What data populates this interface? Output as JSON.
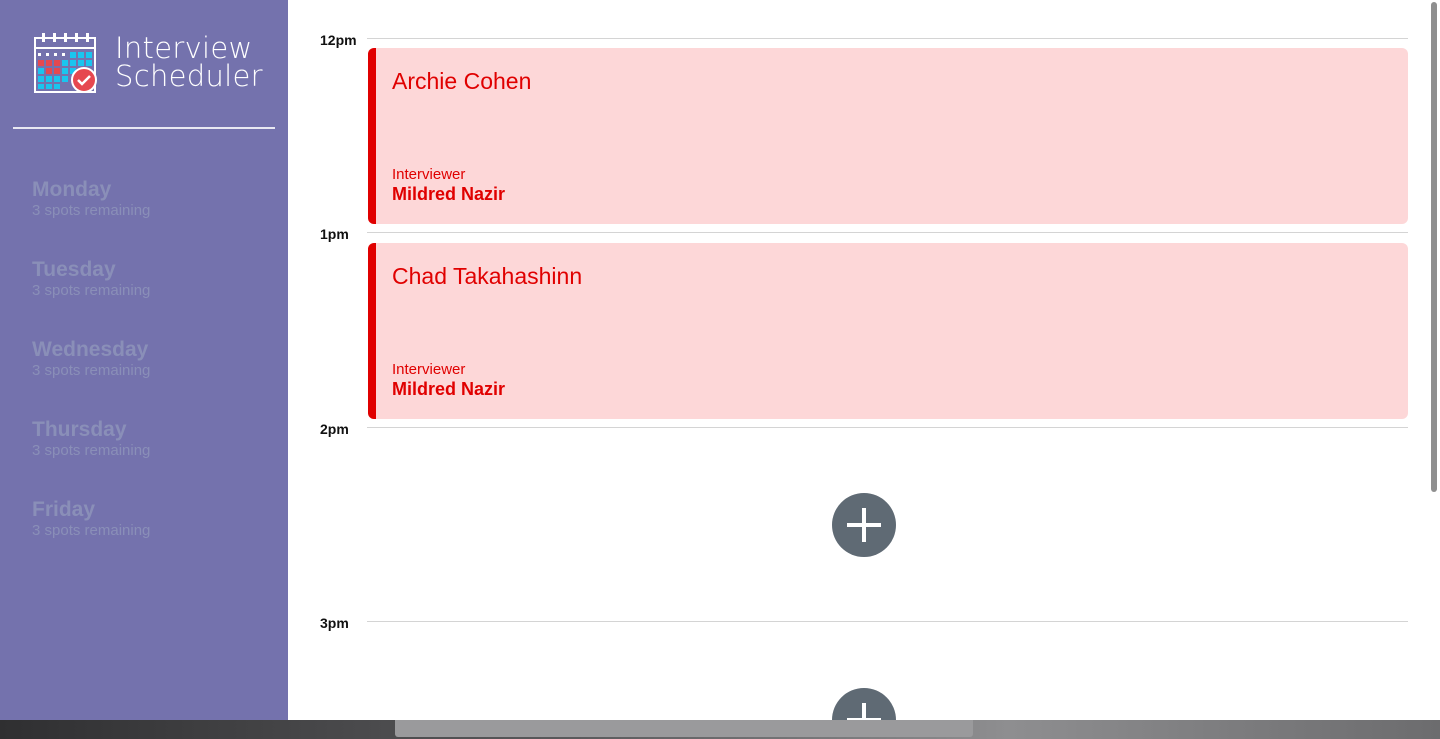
{
  "app": {
    "title_line1": "Interview",
    "title_line2": "Scheduler"
  },
  "sidebar": {
    "days": [
      {
        "name": "Monday",
        "spots": "3 spots remaining"
      },
      {
        "name": "Tuesday",
        "spots": "3 spots remaining"
      },
      {
        "name": "Wednesday",
        "spots": "3 spots remaining"
      },
      {
        "name": "Thursday",
        "spots": "3 spots remaining"
      },
      {
        "name": "Friday",
        "spots": "3 spots remaining"
      }
    ]
  },
  "schedule": {
    "times": [
      "12pm",
      "1pm",
      "2pm",
      "3pm"
    ],
    "appointments": [
      {
        "student": "Archie Cohen",
        "interviewer_label": "Interviewer",
        "interviewer": "Mildred Nazir"
      },
      {
        "student": "Chad Takahashinn",
        "interviewer_label": "Interviewer",
        "interviewer": "Mildred Nazir"
      }
    ]
  },
  "colors": {
    "sidebar_bg": "#7472ad",
    "appointment_bg": "#fdd7d8",
    "appointment_accent": "#e00000",
    "add_button": "#5f6a74"
  },
  "icons": {
    "logo": "calendar-check-icon",
    "add": "plus-icon"
  }
}
